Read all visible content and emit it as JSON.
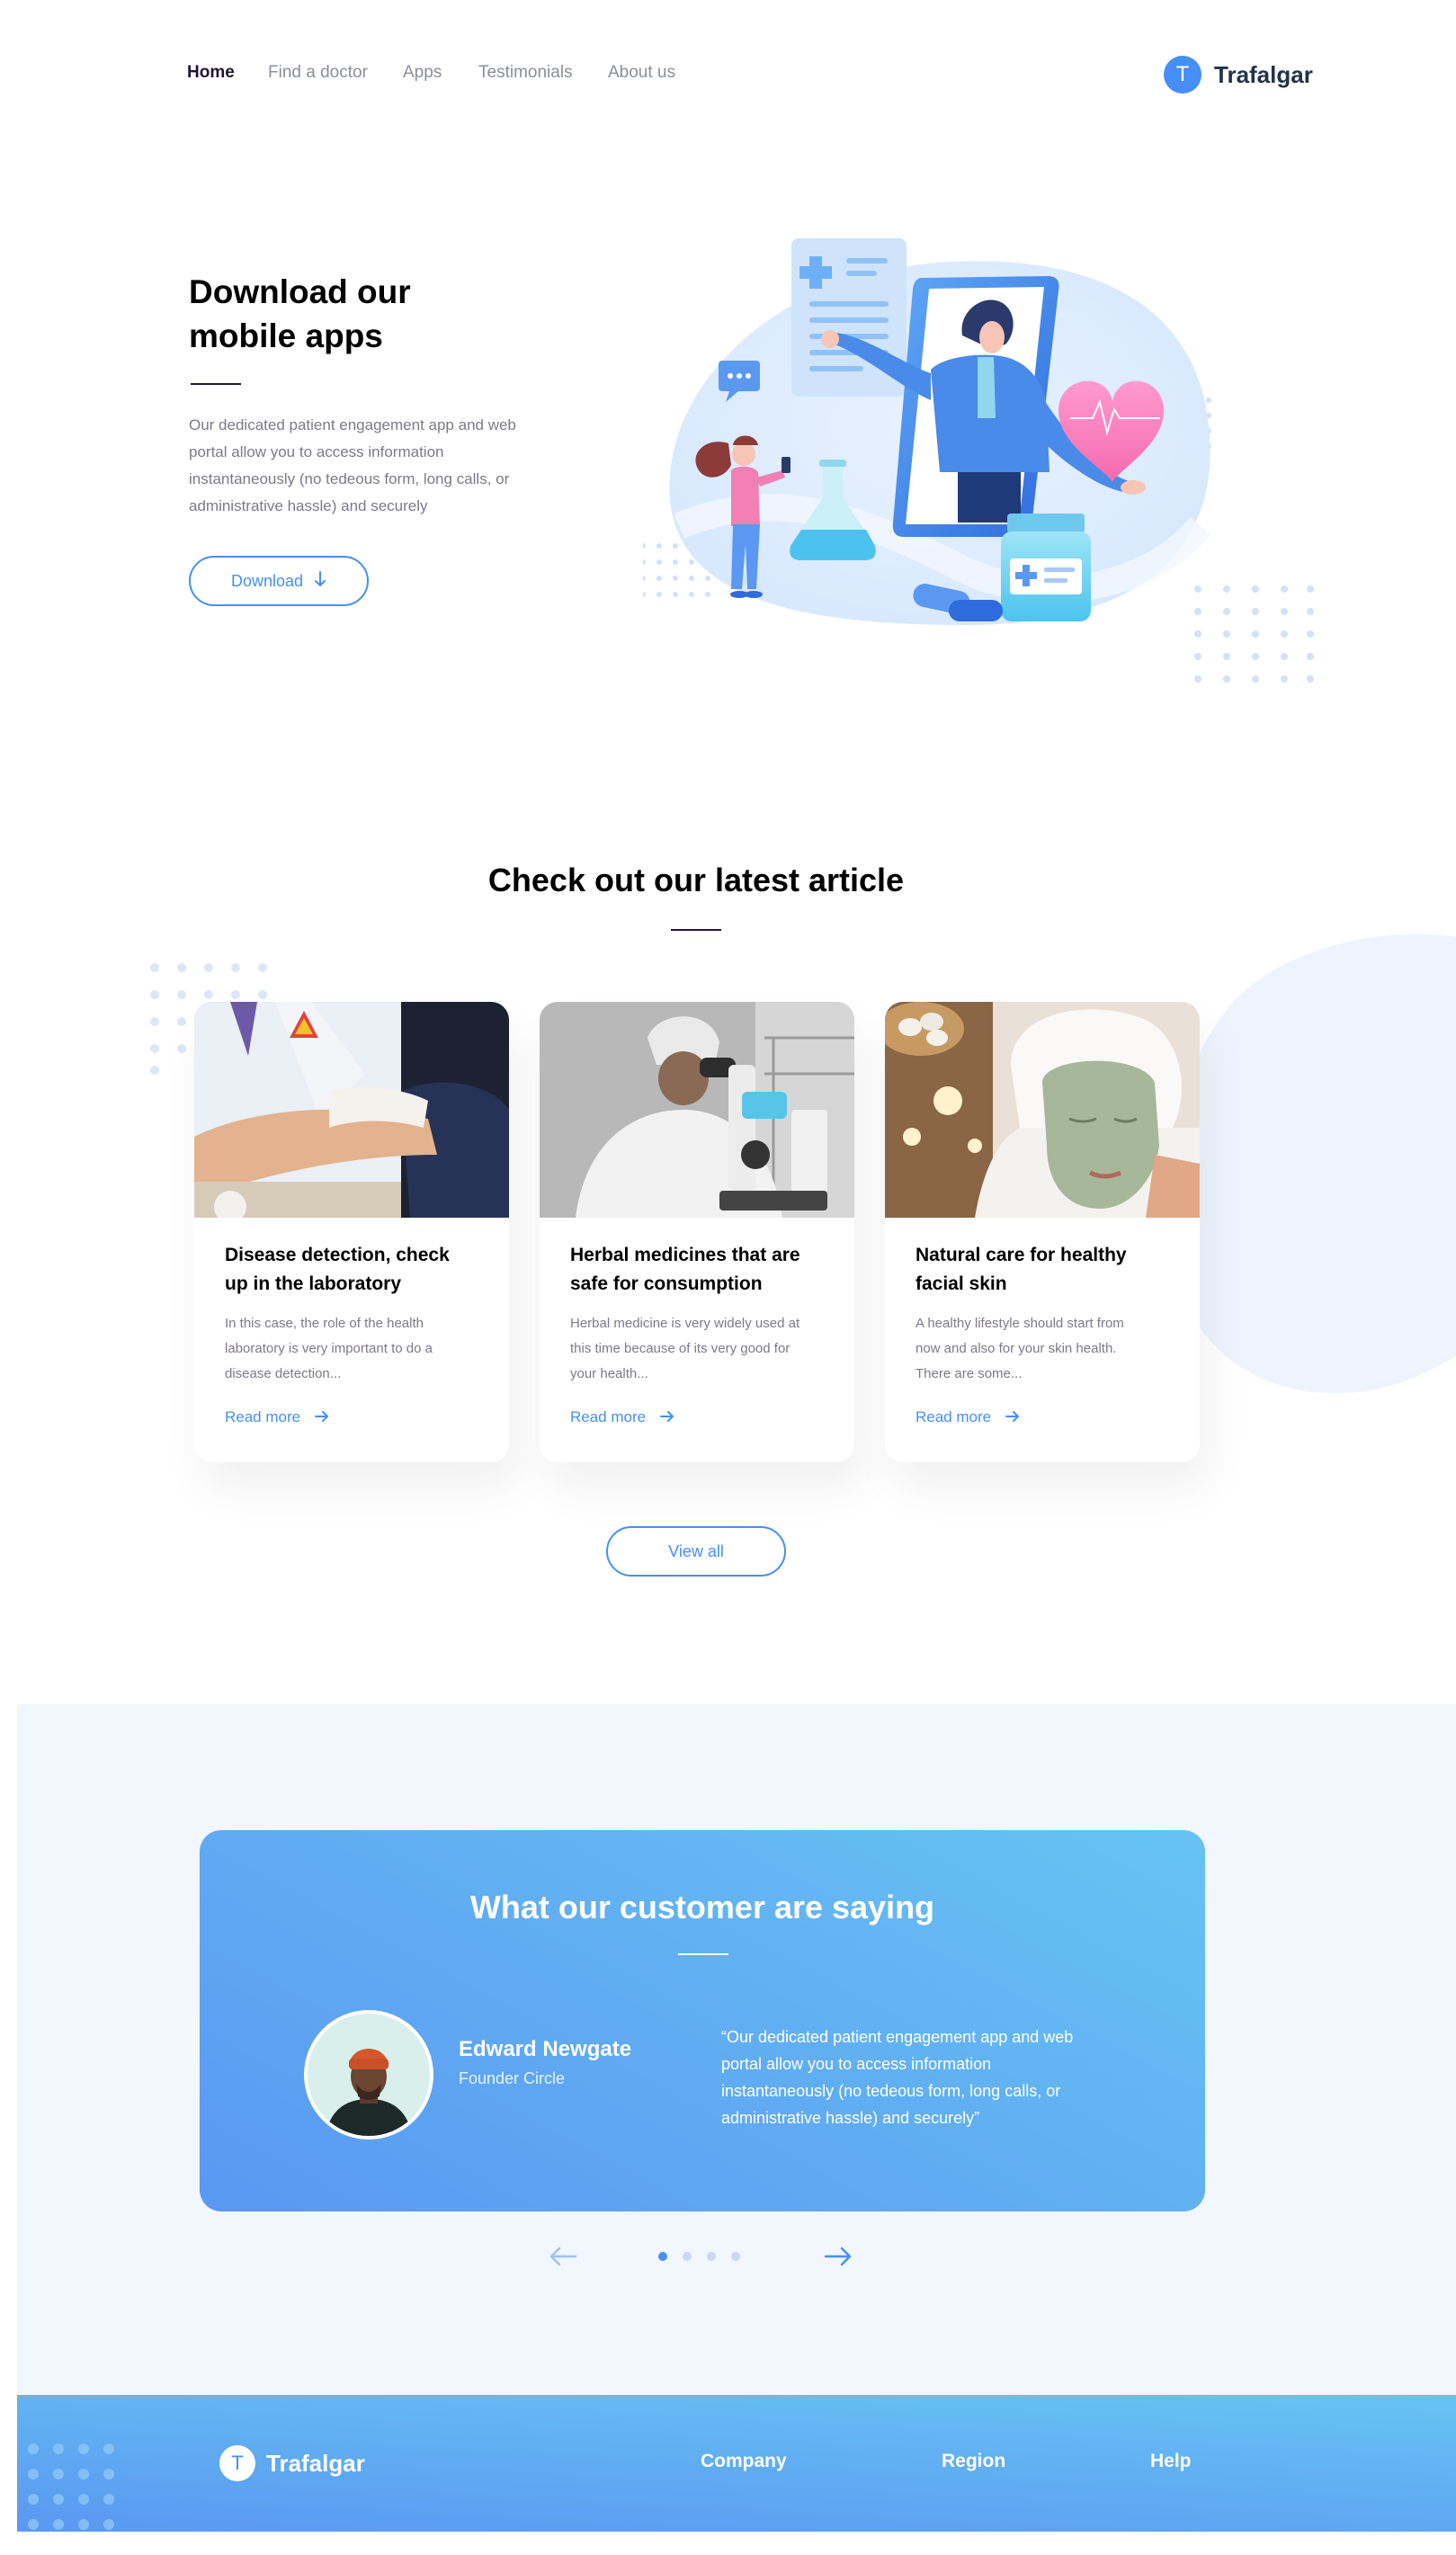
{
  "nav": {
    "links": [
      "Home",
      "Find a doctor",
      "Apps",
      "Testimonials",
      "About us"
    ],
    "active": "Home"
  },
  "brand": {
    "initial": "T",
    "name": "Trafalgar"
  },
  "hero": {
    "title": "Download our mobile apps",
    "description": "Our dedicated patient engagement app and web portal allow you to access information instantaneously (no tedeous form, long calls, or administrative hassle) and securely",
    "button_label": "Download",
    "button_icon": "arrow-down-icon"
  },
  "articles": {
    "title": "Check out our latest article",
    "cards": [
      {
        "title": "Disease detection, check up in the laboratory",
        "description": "In this case, the role of the health laboratory is very important to do a disease detection...",
        "link": "Read more"
      },
      {
        "title": "Herbal medicines that are safe for consumption",
        "description": "Herbal medicine is very widely used at this time because of its very good for your health...",
        "link": "Read more"
      },
      {
        "title": "Natural care for healthy facial skin",
        "description": "A healthy lifestyle should start from now and also for your skin health. There are some...",
        "link": "Read more"
      }
    ],
    "view_all": "View all"
  },
  "testimonial": {
    "title": "What our customer are saying",
    "name": "Edward Newgate",
    "role": "Founder Circle",
    "quote": "“Our dedicated patient engagement app and web portal allow you to access information instantaneously (no tedeous form, long calls, or administrative hassle) and securely”",
    "active_slide": 1,
    "slide_count": 4
  },
  "footer": {
    "brand_initial": "T",
    "brand_name": "Trafalgar",
    "links": [
      "Company",
      "Region",
      "Help"
    ]
  },
  "colors": {
    "primary": "#458ff6",
    "heading": "#000000",
    "body_text": "#7d7987",
    "testimonial_gradient_start": "#67c3f3",
    "testimonial_gradient_end": "#5a98f2",
    "section_bg": "#f2f6fd"
  }
}
